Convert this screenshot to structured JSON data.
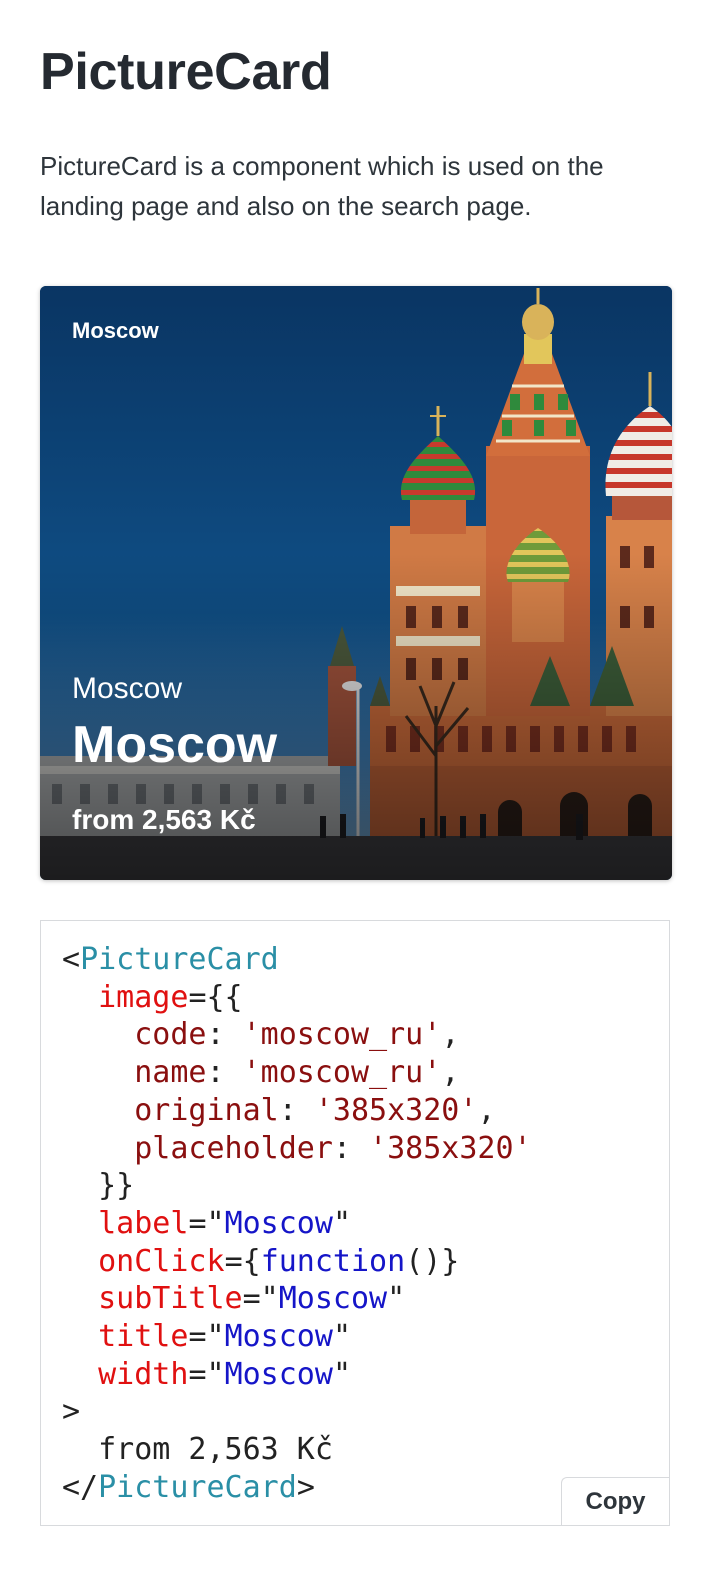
{
  "page": {
    "title": "PictureCard",
    "description": "PictureCard is a component which is used on the landing page and also on the search page."
  },
  "card": {
    "label": "Moscow",
    "subtitle": "Moscow",
    "title": "Moscow",
    "price": "from 2,563 Kč"
  },
  "code": {
    "tag_name": "PictureCard",
    "image_attr": "image",
    "image_fields": [
      {
        "key": "code",
        "value": "'moscow_ru'"
      },
      {
        "key": "name",
        "value": "'moscow_ru'"
      },
      {
        "key": "original",
        "value": "'385x320'"
      },
      {
        "key": "placeholder",
        "value": "'385x320'"
      }
    ],
    "props": [
      {
        "name": "label",
        "value": "Moscow"
      },
      {
        "name": "subTitle",
        "value": "Moscow"
      },
      {
        "name": "title",
        "value": "Moscow"
      },
      {
        "name": "width",
        "value": "Moscow"
      }
    ],
    "onclick_name": "onClick",
    "onclick_value": "function",
    "children": "from 2,563 Kč",
    "copy_label": "Copy"
  },
  "colors": {
    "heading": "#252a31",
    "tag": "#2a8fa6",
    "attribute": "#e01010",
    "string": "#8a0f0f",
    "value": "#1515c8"
  }
}
